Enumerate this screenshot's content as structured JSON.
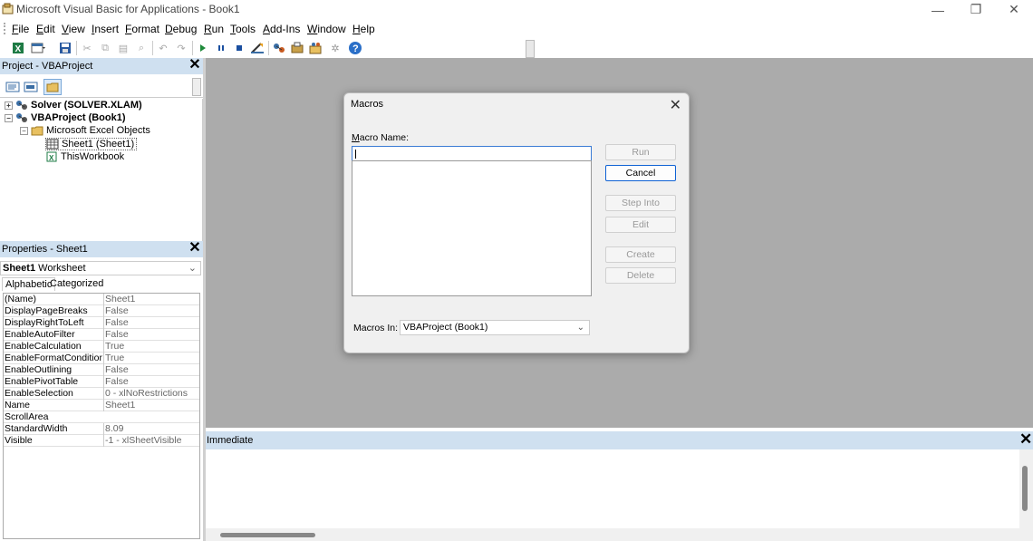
{
  "window": {
    "title": "Microsoft Visual Basic for Applications - Book1",
    "minimize": "—",
    "restore": "❐",
    "close": "✕"
  },
  "menu": [
    {
      "label": "File",
      "u": "F",
      "rest": "ile"
    },
    {
      "label": "Edit",
      "u": "E",
      "rest": "dit"
    },
    {
      "label": "View",
      "u": "V",
      "rest": "iew"
    },
    {
      "label": "Insert",
      "u": "I",
      "rest": "nsert"
    },
    {
      "label": "Format",
      "u": "F",
      "rest": "ormat"
    },
    {
      "label": "Debug",
      "u": "D",
      "rest": "ebug"
    },
    {
      "label": "Run",
      "u": "R",
      "rest": "un"
    },
    {
      "label": "Tools",
      "u": "T",
      "rest": "ools"
    },
    {
      "label": "Add-Ins",
      "u": "A",
      "rest": "dd-Ins"
    },
    {
      "label": "Window",
      "u": "W",
      "rest": "indow"
    },
    {
      "label": "Help",
      "u": "H",
      "rest": "elp"
    }
  ],
  "project": {
    "title": "Project - VBAProject",
    "tree": {
      "solver": "Solver (SOLVER.XLAM)",
      "vbaproject": "VBAProject (Book1)",
      "excel_objects": "Microsoft Excel Objects",
      "sheet1": "Sheet1 (Sheet1)",
      "thisworkbook": "ThisWorkbook"
    }
  },
  "properties": {
    "title": "Properties - Sheet1",
    "object_name": "Sheet1",
    "object_type": "Worksheet",
    "tab_alpha": "Alphabetic",
    "tab_cat": "Categorized",
    "rows": [
      {
        "name": "(Name)",
        "value": "Sheet1"
      },
      {
        "name": "DisplayPageBreaks",
        "value": "False"
      },
      {
        "name": "DisplayRightToLeft",
        "value": "False"
      },
      {
        "name": "EnableAutoFilter",
        "value": "False"
      },
      {
        "name": "EnableCalculation",
        "value": "True"
      },
      {
        "name": "EnableFormatConditionsC",
        "value": "True"
      },
      {
        "name": "EnableOutlining",
        "value": "False"
      },
      {
        "name": "EnablePivotTable",
        "value": "False"
      },
      {
        "name": "EnableSelection",
        "value": "0 - xlNoRestrictions"
      },
      {
        "name": "Name",
        "value": "Sheet1"
      },
      {
        "name": "ScrollArea",
        "value": ""
      },
      {
        "name": "StandardWidth",
        "value": "8.09"
      },
      {
        "name": "Visible",
        "value": "-1 - xlSheetVisible"
      }
    ]
  },
  "immediate": {
    "title": "Immediate"
  },
  "dialog": {
    "title": "Macros",
    "macro_name_label": "Macro Name:",
    "macro_name_value": "",
    "buttons": {
      "run": "Run",
      "cancel": "Cancel",
      "step_into": "Step Into",
      "edit": "Edit",
      "create": "Create",
      "delete": "Delete"
    },
    "macros_in_label": "Macros In:",
    "macros_in_value": "VBAProject (Book1)"
  },
  "colors": {
    "mdi_background": "#ababab",
    "panel_header": "#cfe0f0",
    "dialog_accent": "#0f62d4"
  }
}
